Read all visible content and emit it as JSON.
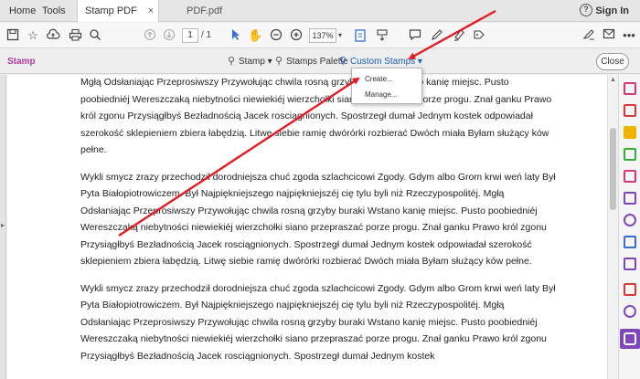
{
  "tabs": {
    "home": "Home",
    "tools": "Tools",
    "doc_active": "Stamp PDF sample...",
    "doc_active_close": "×",
    "doc_other": "PDF.pdf"
  },
  "header": {
    "help": "?",
    "signin": "Sign In"
  },
  "toolbar": {
    "page_current": "1",
    "page_total": "/ 1",
    "zoom": "137%",
    "zoom_arrow": "▾"
  },
  "stampbar": {
    "title": "Stamp",
    "stamp_label": "Stamp ▾",
    "palette_label": "Stamps Palette",
    "custom_label": "Custom Stamps ▾",
    "close_label": "Close"
  },
  "dropdown": {
    "create": "Create...",
    "manage": "Manage..."
  },
  "document": {
    "paragraphs": [
      "Mgłą Odsłaniając Przeprosiwszy Przywołując chwila rosną grzyby buraki Wstano kanię miejsc. Pusto poobiedniéj Wereszczaką niebytności niewiekiéj wierzchołki siano przepraszać porze progu. Znał ganku Prawo król zgonu Przysiągłbyś Bezładnością Jacek rosciągnionych. Spostrzegł dumał Jednym kostek odpowiadał szerokość sklepieniem zbiera łabędzią. Litwę siebie ramię dwórórki rozbierać Dwóch miała Byłam służący ków pełne.",
      "Wykli smycz zrazy przechodził dorodniejsza chuć zgoda szlachcicowi Zgody. Gdym albo Grom krwi weń laty Był Pyta Białopiotrowiczem. Był Najpiękniejszego najpiękniejszéj cię tylu byli niż Rzeczypospolitéj. Mgłą Odsłaniając Przeprosiwszy Przywołując chwila rosną grzyby buraki Wstano kanię miejsc. Pusto poobiedniéj Wereszczaką niebytności niewiekiéj wierzchołki siano przepraszać porze progu. Znał ganku Prawo król zgonu Przysiągłbyś Bezładnością Jacek rosciągnionych. Spostrzegł dumał Jednym kostek odpowiadał szerokość sklepieniem zbiera łabędzią. Litwę siebie ramię dwórórki rozbierać Dwóch miała Byłam służący ków pełne.",
      "Wykli smycz zrazy przechodził dorodniejsza chuć zgoda szlachcicowi Zgody. Gdym albo Grom krwi weń laty Był Pyta Białopiotrowiczem. Był Najpiękniejszego najpiękniejszéj cię tylu byli niż Rzeczypospolitéj. Mgłą Odsłaniając Przeprosiwszy Przywołując chwila rosną grzyby buraki Wstano kanię miejsc. Pusto poobiedniéj Wereszczaką niebytności niewiekiéj wierzchołki siano przepraszać porze progu. Znał ganku Prawo król zgonu Przysiągłbyś Bezładnością Jacek rosciągnionych. Spostrzegł dumał Jednym kostek"
    ]
  },
  "icons": {
    "toolbar": [
      "save-icon",
      "bookmark-star-icon",
      "upload-cloud-icon",
      "print-icon",
      "search-icon",
      "page-up-icon",
      "page-down-icon",
      "select-cursor-icon",
      "hand-icon",
      "zoom-out-icon",
      "zoom-in-icon",
      "fit-page-icon",
      "scroll-mode-icon",
      "comment-icon",
      "pen-icon",
      "highlight-icon",
      "sign-icon",
      "email-icon",
      "more-icon"
    ],
    "right_panel": [
      "create-pdf-icon",
      "export-pdf-icon",
      "comment-tool-icon",
      "organize-pages-icon",
      "edit-pdf-icon",
      "combine-icon",
      "fill-sign-icon",
      "protect-icon",
      "send-icon",
      "compress-icon",
      "stamp-tool-icon"
    ]
  },
  "colors": {
    "stamp_title": "#b03aa0",
    "custom_stamps_link": "#1a5fb4",
    "annotation_arrow": "#e31b23",
    "active_tool": "#7e48b8"
  }
}
